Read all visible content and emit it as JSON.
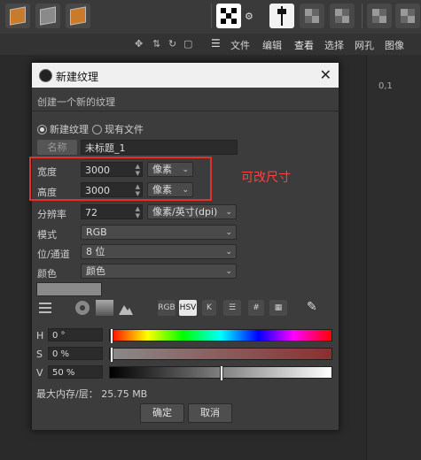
{
  "menubar": {
    "items": [
      "文件",
      "编辑",
      "查看",
      "选择",
      "网孔",
      "图像"
    ]
  },
  "viewport": {
    "coord": "0,1"
  },
  "dialog": {
    "title": "新建纹理",
    "subtitle": "创建一个新的纹理",
    "radio_new": "新建纹理",
    "radio_existing": "现有文件",
    "name_button": "名称",
    "name_value": "未标题_1",
    "width_label": "宽度",
    "width_value": "3000",
    "width_unit": "像素",
    "height_label": "高度",
    "height_value": "3000",
    "height_unit": "像素",
    "resolution_label": "分辨率",
    "resolution_value": "72",
    "resolution_unit": "像素/英寸(dpi)",
    "mode_label": "模式",
    "mode_value": "RGB",
    "depth_label": "位/通道",
    "depth_value": "8 位",
    "color_label": "颜色",
    "color_value": "颜色",
    "color_tabs": [
      "RGB",
      "HSV",
      "K"
    ],
    "hue_label": "H",
    "hue_value": "0 °",
    "sat_label": "S",
    "sat_value": "0 %",
    "val_label": "V",
    "val_value": "50 %",
    "memory": "最大内存/层：  25.75 MB",
    "ok": "确定",
    "cancel": "取消"
  },
  "annotation": {
    "text": "可改尺寸",
    "color": "#e03030"
  },
  "levels": {
    "hue": 0,
    "saturation": 0,
    "value": 0.5
  }
}
